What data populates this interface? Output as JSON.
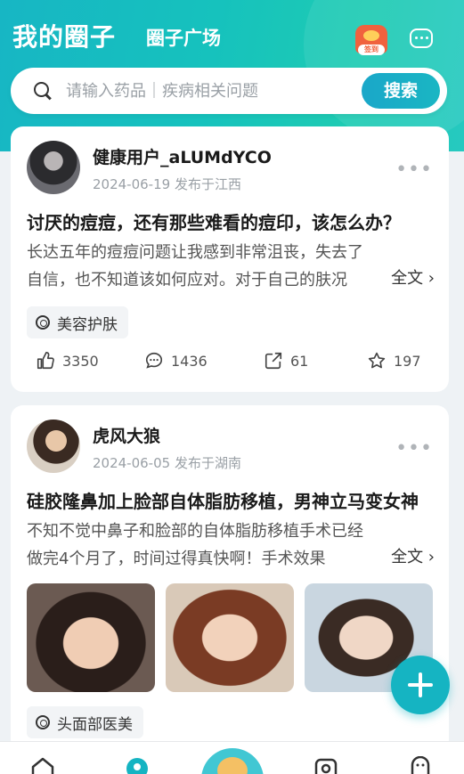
{
  "header": {
    "tab_active": "我的圈子",
    "tab_other": "圈子广场",
    "sign_label": "签到"
  },
  "search": {
    "placeholder": "请输入药品｜疾病相关问题",
    "button_label": "搜索"
  },
  "posts": [
    {
      "username": "健康用户_aLUMdYCO",
      "meta": "2024-06-19 发布于江西",
      "title": "讨厌的痘痘，还有那些难看的痘印，该怎么办？",
      "body": "长达五年的痘痘问题让我感到非常沮丧，失去了自信，也不知道该如何应对。对于自己的肤况",
      "full_text_label": "全文 ›",
      "tag": "美容护肤",
      "likes": "3350",
      "comments": "1436",
      "shares": "61",
      "favorites": "197"
    },
    {
      "username": "虎风大狼",
      "meta": "2024-06-05 发布于湖南",
      "title": "硅胶隆鼻加上脸部自体脂肪移植，男神立马变女神",
      "body": "不知不觉中鼻子和脸部的自体脂肪移植手术已经做完4个月了，时间过得真快啊！手术效果",
      "full_text_label": "全文 ›",
      "tag": "头面部医美"
    }
  ],
  "colors": {
    "brand": "#15b4c2",
    "header_gradient_start": "#17b6c4",
    "header_gradient_end": "#26c9c0"
  },
  "icons": [
    "search-icon",
    "sign-in-icon",
    "message-icon",
    "more-icon",
    "tag-icon",
    "like-icon",
    "comment-icon",
    "share-icon",
    "star-icon",
    "add-icon",
    "home-icon",
    "circle-icon",
    "mascot-icon",
    "scan-icon",
    "profile-icon"
  ]
}
